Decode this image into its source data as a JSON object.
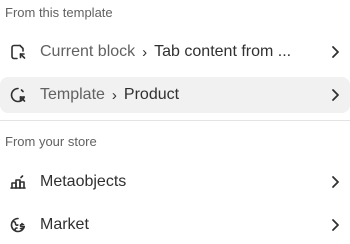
{
  "sections": {
    "template": {
      "label": "From this template",
      "rows": [
        {
          "icon": "block-icon",
          "prefix": "Current block",
          "value": "Tab content from ..."
        },
        {
          "icon": "template-icon",
          "prefix": "Template",
          "value": "Product"
        }
      ]
    },
    "store": {
      "label": "From your store",
      "rows": [
        {
          "icon": "metaobjects-icon",
          "value": "Metaobjects"
        },
        {
          "icon": "market-icon",
          "value": "Market"
        }
      ]
    }
  },
  "colors": {
    "text": "#303030",
    "muted": "#616161",
    "highlight": "#f1f1f1",
    "divider": "#e3e3e3"
  }
}
